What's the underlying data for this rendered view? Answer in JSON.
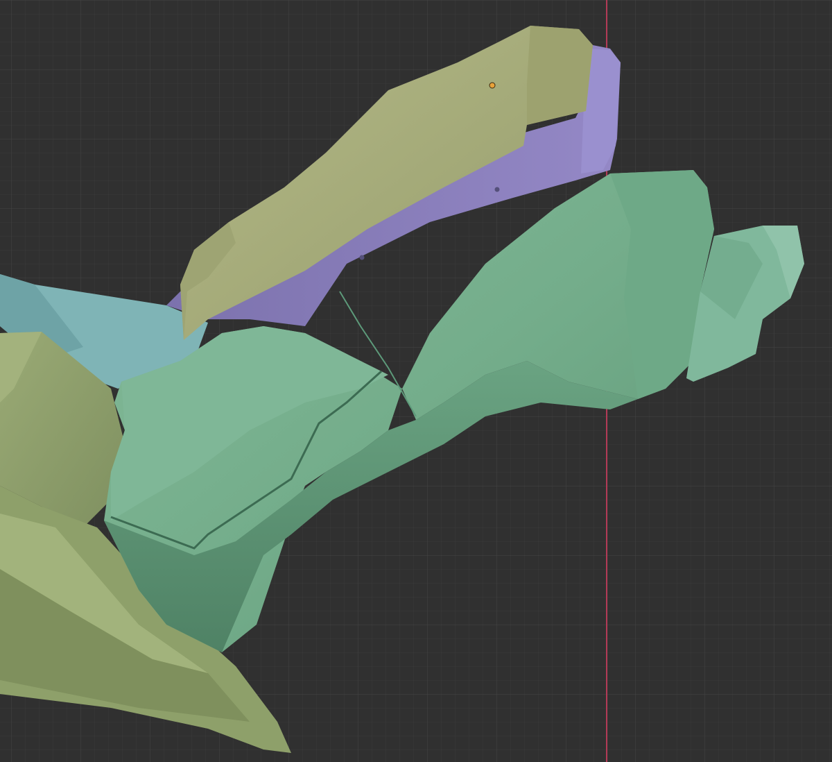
{
  "viewport": {
    "background": "#303030",
    "grid_minor_color": "#3a3a3a",
    "grid_major_color": "#474747",
    "axis_color": "#b23a56",
    "origin_color": "#e8a23a"
  },
  "model": {
    "parts": [
      {
        "name": "armor-plate-olive",
        "color": "#a9ae7d"
      },
      {
        "name": "armor-underlayer-purple",
        "color": "#8b80bd"
      },
      {
        "name": "armor-body-green",
        "color": "#74ae8c"
      },
      {
        "name": "armor-tail-green",
        "color": "#80b89c"
      },
      {
        "name": "armor-cyan-panel",
        "color": "#7fb4b6"
      },
      {
        "name": "armor-olive-left",
        "color": "#8fa06c"
      }
    ]
  }
}
